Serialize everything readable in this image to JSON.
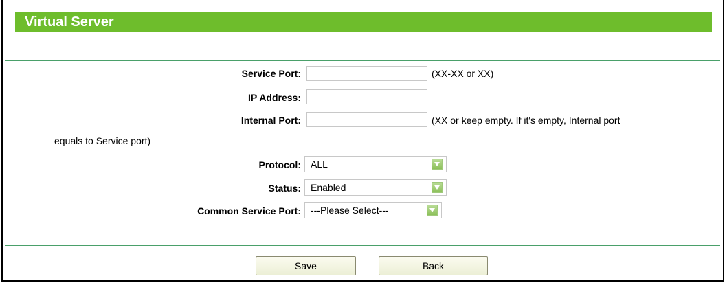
{
  "page": {
    "title": "Virtual Server"
  },
  "form": {
    "service_port": {
      "label": "Service Port:",
      "value": "",
      "hint": "(XX-XX or XX)"
    },
    "ip_address": {
      "label": "IP Address:",
      "value": ""
    },
    "internal_port": {
      "label": "Internal Port:",
      "value": "",
      "hint_line1": "(XX or keep empty. If it's empty, Internal port",
      "hint_line2": "equals to Service port)"
    },
    "protocol": {
      "label": "Protocol:",
      "selected": "ALL"
    },
    "status": {
      "label": "Status:",
      "selected": "Enabled"
    },
    "common_service_port": {
      "label": "Common Service Port:",
      "selected": "---Please Select---"
    }
  },
  "buttons": {
    "save_label": "Save",
    "back_label": "Back"
  },
  "colors": {
    "title_bar": "#6ebd2c",
    "divider": "#4aa06a",
    "dropdown_arrow": "#8cc05a"
  },
  "icons": {
    "dropdown": "chevron-down-icon"
  }
}
